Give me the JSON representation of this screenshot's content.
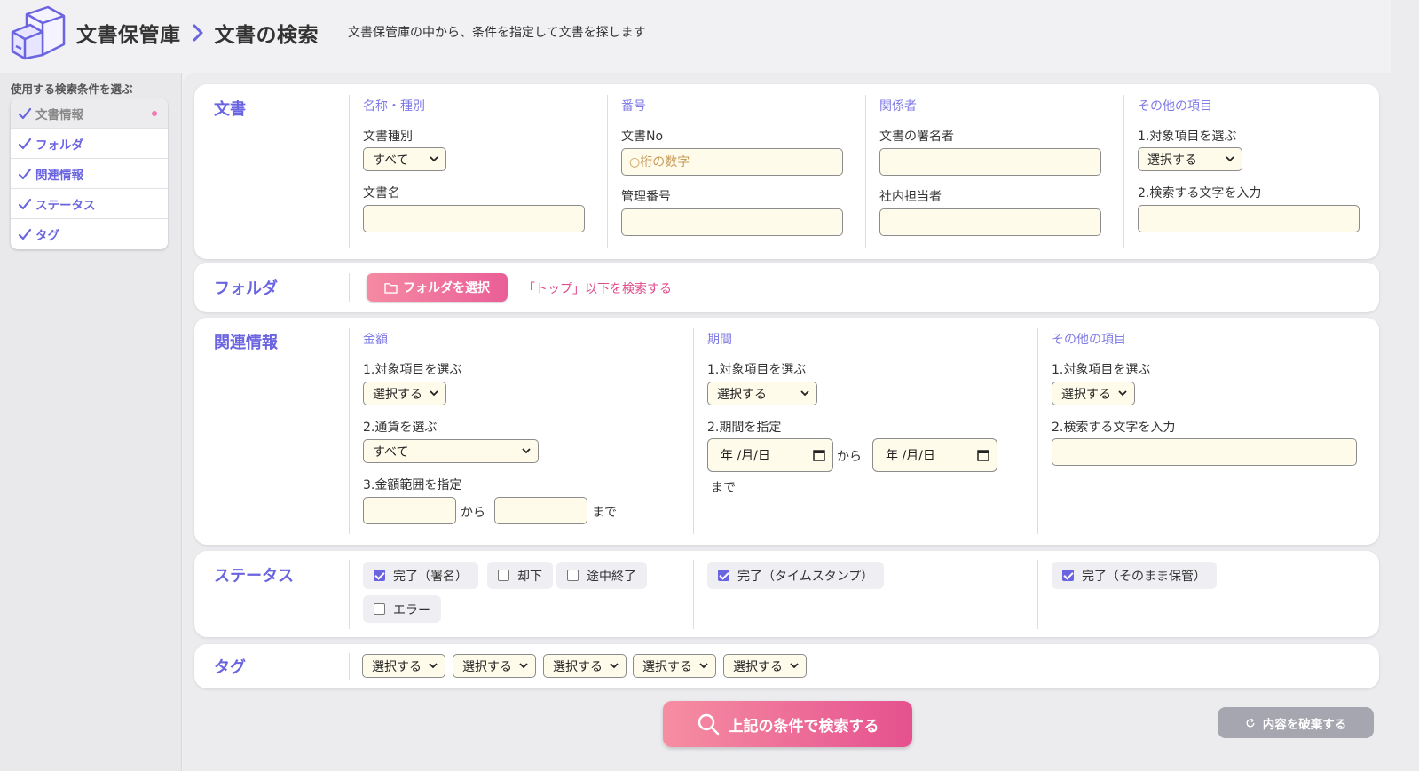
{
  "header": {
    "crumb1": "文書保管庫",
    "crumb2": "文書の検索",
    "description": "文書保管庫の中から、条件を指定して文書を探します"
  },
  "sidebar": {
    "title": "使用する検索条件を選ぶ",
    "items": [
      {
        "label": "文書情報"
      },
      {
        "label": "フォルダ"
      },
      {
        "label": "関連情報"
      },
      {
        "label": "ステータス"
      },
      {
        "label": "タグ"
      }
    ]
  },
  "doc": {
    "title": "文書",
    "name_col": {
      "title": "名称・種別",
      "type_label": "文書種別",
      "type_value": "すべて",
      "name_label": "文書名",
      "name_value": ""
    },
    "number_col": {
      "title": "番号",
      "no_label": "文書No",
      "no_placeholder": "○桁の数字",
      "mgmt_label": "管理番号",
      "mgmt_value": ""
    },
    "people_col": {
      "title": "関係者",
      "signer_label": "文書の署名者",
      "signer_value": "",
      "staff_label": "社内担当者",
      "staff_value": ""
    },
    "other_col": {
      "title": "その他の項目",
      "step1_label": "1.対象項目を選ぶ",
      "step1_value": "選択する",
      "step2_label": "2.検索する文字を入力",
      "step2_value": ""
    }
  },
  "folder": {
    "title": "フォルダ",
    "button_label": "フォルダを選択",
    "hint": "「トップ」以下を検索する"
  },
  "related": {
    "title": "関連情報",
    "amount_col": {
      "title": "金額",
      "step1_label": "1.対象項目を選ぶ",
      "step1_value": "選択する",
      "step2_label": "2.通貨を選ぶ",
      "step2_value": "すべて",
      "step3_label": "3.金額範囲を指定",
      "from_word": "から",
      "to_word": "まで"
    },
    "period_col": {
      "title": "期間",
      "step1_label": "1.対象項目を選ぶ",
      "step1_value": "選択する",
      "step2_label": "2.期間を指定",
      "date_from": "年 /月/日",
      "date_to": "年 /月/日",
      "from_word": "から",
      "to_word": "まで"
    },
    "other_col": {
      "title": "その他の項目",
      "step1_label": "1.対象項目を選ぶ",
      "step1_value": "選択する",
      "step2_label": "2.検索する文字を入力",
      "step2_value": ""
    }
  },
  "status": {
    "title": "ステータス",
    "options": [
      {
        "label": "完了（署名）",
        "checked": true
      },
      {
        "label": "却下",
        "checked": false
      },
      {
        "label": "途中終了",
        "checked": false
      },
      {
        "label": "エラー",
        "checked": false
      },
      {
        "label": "完了（タイムスタンプ）",
        "checked": true
      },
      {
        "label": "完了（そのまま保管）",
        "checked": true
      }
    ]
  },
  "tags": {
    "title": "タグ",
    "selects": [
      "選択する",
      "選択する",
      "選択する",
      "選択する",
      "選択する"
    ]
  },
  "actions": {
    "search_label": "上記の条件で検索する",
    "reset_label": "内容を破棄する"
  },
  "colors": {
    "accent": "#6a64e0",
    "pink": "#e5518f",
    "input_bg": "#fffbea"
  }
}
